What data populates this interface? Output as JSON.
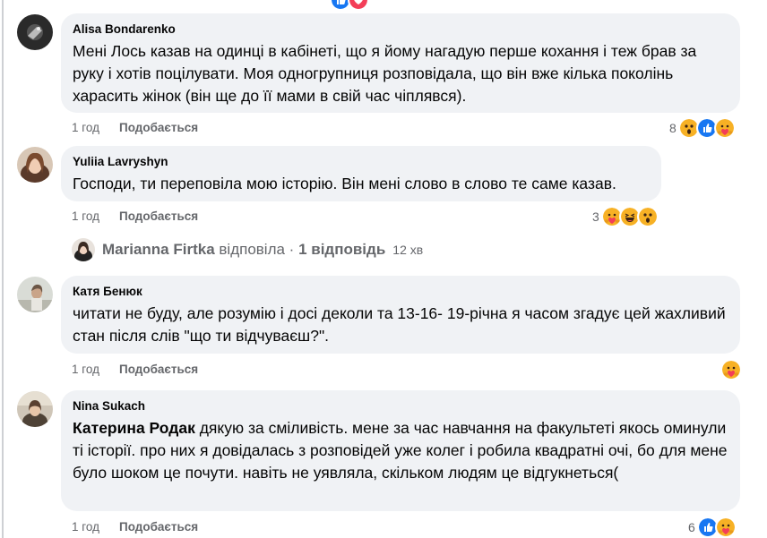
{
  "top_reactions": [
    "like",
    "love"
  ],
  "comments": [
    {
      "author": "Alisa Bondarenko",
      "text": "Мені Лось казав на одинці в кабінеті, що я йому нагадую перше кохання і теж брав за руку і хотів поцілувати. Моя одногрупниця розповідала, що він вже кілька поколінь харасить жінок (він ще до її мами в свій час чіплявся).",
      "time": "1 год",
      "like": "Подобається",
      "reaction_count": "8",
      "reactions": [
        "wow",
        "like",
        "care"
      ]
    },
    {
      "author": "Yuliia Lavryshyn",
      "text": "Господи, ти переповіла мою історію. Він мені слово в слово те саме казав.",
      "time": "1 год",
      "like": "Подобається",
      "reaction_count": "3",
      "reactions": [
        "care",
        "haha",
        "wow"
      ]
    },
    {
      "author": "Катя Бенюк",
      "text": "читати не буду, але розумію і досі деколи та 13-16- 19-річна я часом згадує цей жахливий стан після слів \"що ти відчуваєш?\".",
      "time": "1 год",
      "like": "Подобається",
      "reaction_count": "",
      "reactions": [
        "care"
      ]
    },
    {
      "author": "Nina Sukach",
      "mention": "Катерина Родак",
      "text": " дякую за сміливість. мене за час навчання на факультеті якось оминули ті історії. про них я довідалась з розповідей уже колег і робила квадратні очі, бо для мене було шоком це почути. навіть не уявляла, скільком людям це відгукнеться(",
      "time": "1 год",
      "like": "Подобається",
      "reaction_count": "6",
      "reactions": [
        "like",
        "care"
      ]
    }
  ],
  "replies_row": {
    "name": "Marianna Firtka",
    "action": " відповіла · ",
    "count": "1 відповідь",
    "time": "12 хв"
  },
  "colors": {
    "bubble": "#f0f2f5",
    "meta": "#65676b",
    "like_blue": "#1877f2",
    "emoji_yellow": "#f7b125"
  }
}
